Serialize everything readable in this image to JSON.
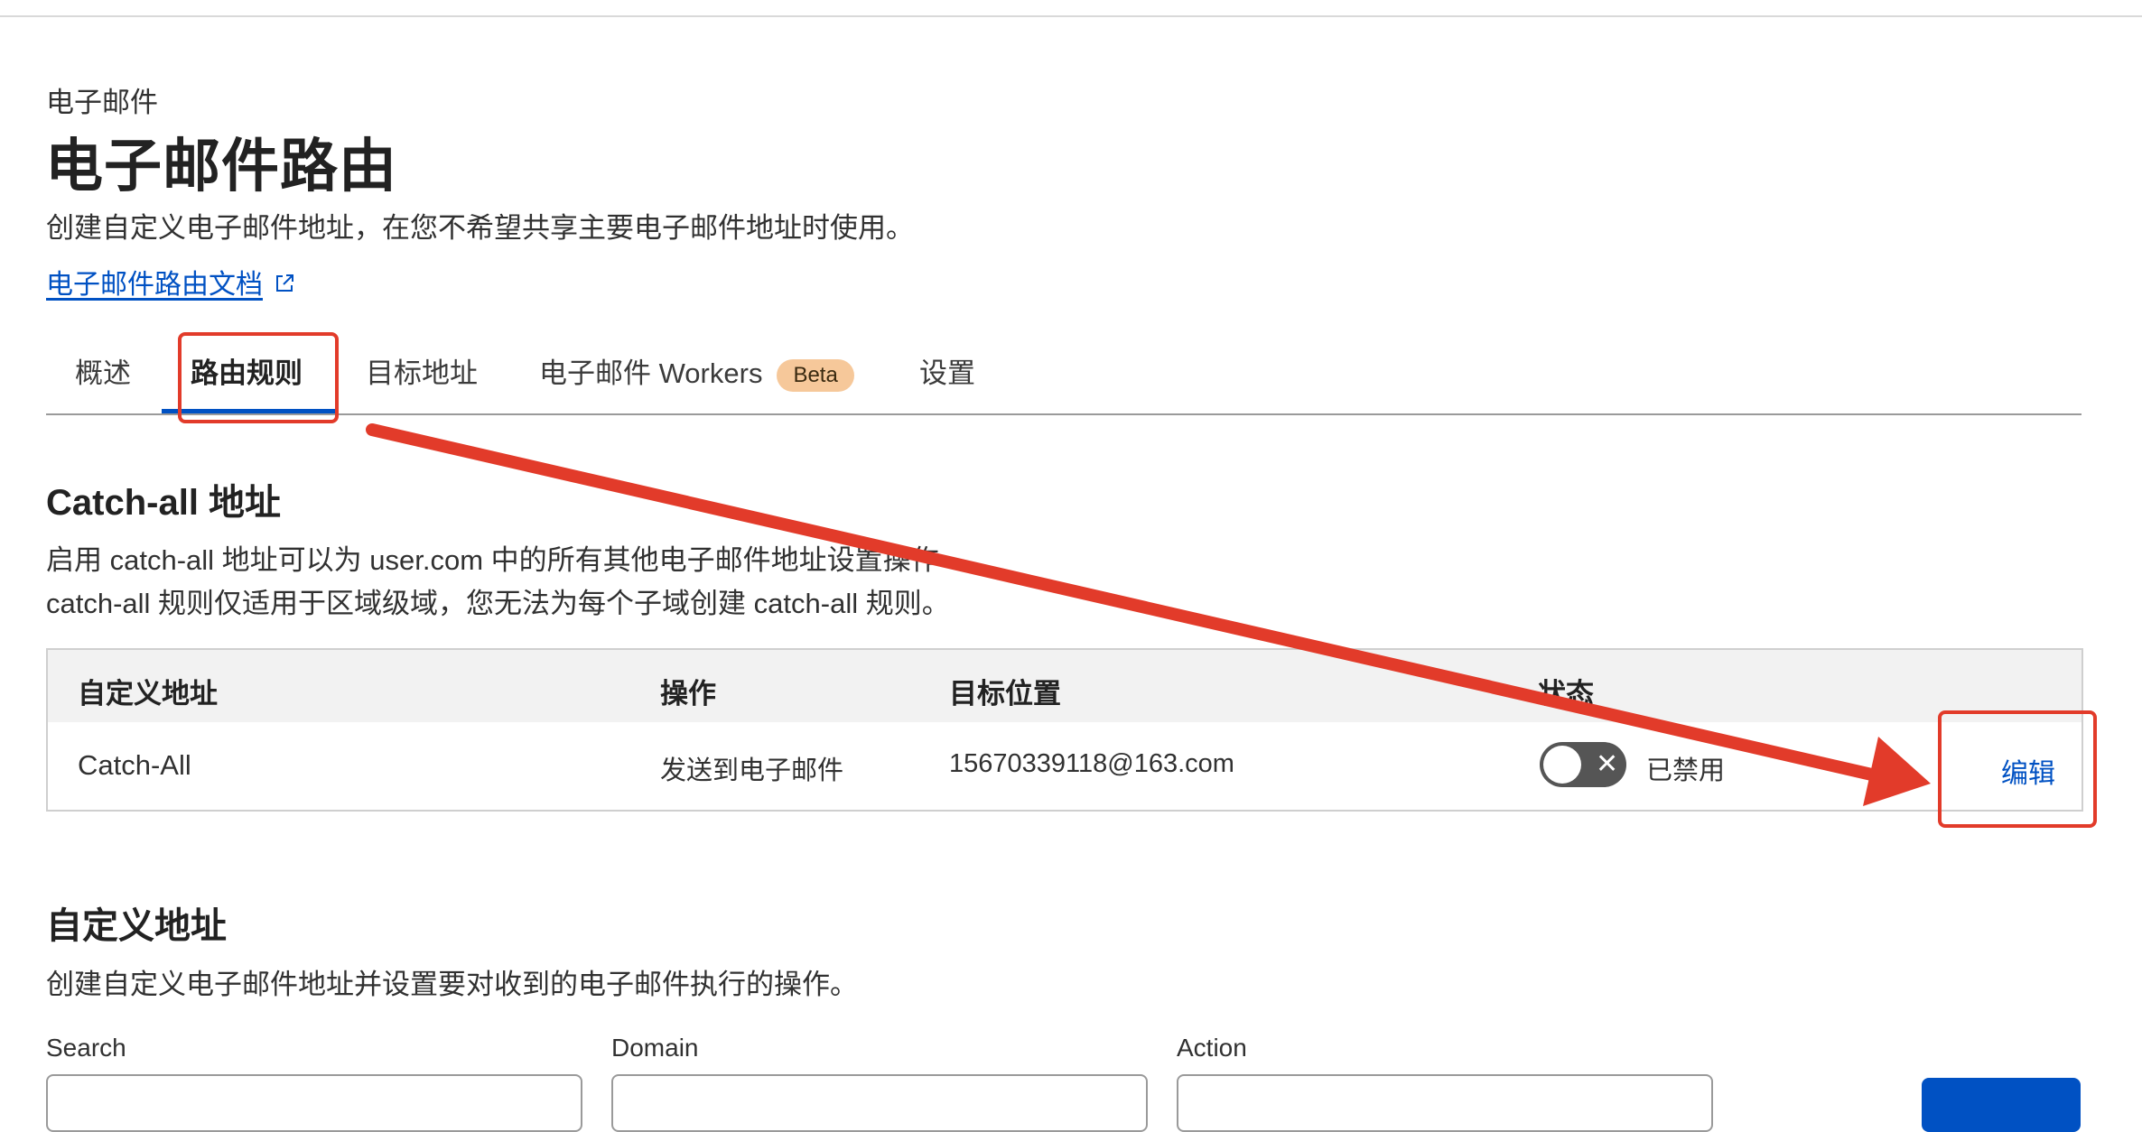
{
  "header": {
    "breadcrumb": "电子邮件",
    "title": "电子邮件路由",
    "description": "创建自定义电子邮件地址，在您不希望共享主要电子邮件地址时使用。",
    "doc_link": "电子邮件路由文档"
  },
  "tabs": [
    {
      "label": "概述",
      "active": false
    },
    {
      "label": "路由规则",
      "active": true
    },
    {
      "label": "目标地址",
      "active": false
    },
    {
      "label": "电子邮件 Workers",
      "badge": "Beta",
      "active": false
    },
    {
      "label": "设置",
      "active": false
    }
  ],
  "catch_all": {
    "title": "Catch-all 地址",
    "desc_line1": "启用 catch-all 地址可以为 user.com 中的所有其他电子邮件地址设置操作",
    "desc_line2": "catch-all 规则仅适用于区域级域，您无法为每个子域创建 catch-all 规则。",
    "columns": [
      "自定义地址",
      "操作",
      "目标位置",
      "状态"
    ],
    "row": {
      "address": "Catch-All",
      "action": "发送到电子邮件",
      "destination": "15670339118@163.com",
      "status": "已禁用",
      "enabled": false,
      "edit_label": "编辑"
    }
  },
  "custom": {
    "title": "自定义地址",
    "desc": "创建自定义电子邮件地址并设置要对收到的电子邮件执行的操作。",
    "filters": {
      "search_label": "Search",
      "search_value": "",
      "domain_label": "Domain",
      "action_label": "Action"
    }
  },
  "annotation": {
    "color": "#e23b2a",
    "accent": "#0051c3"
  }
}
